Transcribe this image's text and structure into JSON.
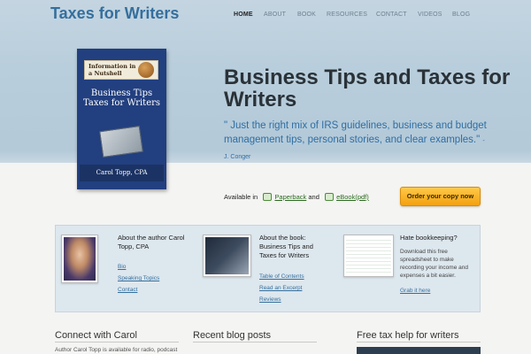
{
  "site": {
    "title": "Taxes for Writers"
  },
  "nav": {
    "items": [
      {
        "label": "HOME",
        "active": true
      },
      {
        "label": "ABOUT",
        "active": false
      },
      {
        "label": "BOOK",
        "active": false
      },
      {
        "label": "RESOURCES",
        "active": false
      },
      {
        "label": "CONTACT",
        "active": false
      },
      {
        "label": "VIDEOS",
        "active": false
      },
      {
        "label": "BLOG",
        "active": false
      }
    ]
  },
  "book_cover": {
    "banner": "Information in a Nutshell",
    "title": "Business Tips Taxes for Writers",
    "author": "Carol Topp, CPA"
  },
  "hero": {
    "heading": "Business Tips and Taxes for Writers",
    "quote": "\" Just the right mix of IRS guidelines, business and budget management tips, personal stories, and clear examples.\"",
    "quote_cite": "- J. Conger"
  },
  "availability": {
    "prefix": "Available in",
    "paperback": "Paperback",
    "and": "and",
    "ebook": "eBook(pdf)"
  },
  "order_button": "Order your copy now",
  "cards": [
    {
      "title": "About the author Carol Topp, CPA",
      "links": [
        "Bio",
        "Speaking Topics",
        "Contact"
      ],
      "image_icon": "author-photo"
    },
    {
      "title": "About the book: Business Tips and Taxes for Writers",
      "links": [
        "Table of Contents",
        "Read an Excerpt",
        "Reviews"
      ],
      "image_icon": "profit-image"
    },
    {
      "title": "Hate bookkeeping?",
      "text": "Download this free spreadsheet to make recording your income and expenses a bit easier.",
      "links": [
        "Grab it here"
      ],
      "image_icon": "spreadsheet-image"
    }
  ],
  "footer_columns": [
    {
      "heading": "Connect with Carol",
      "text": "Author Carol Topp is available for radio, podcast"
    },
    {
      "heading": "Recent blog posts",
      "text": ""
    },
    {
      "heading": "Free tax help for writers",
      "text": ""
    }
  ],
  "colors": {
    "accent": "#356f9d",
    "order_button": "#f3a10e",
    "link_green": "#2b6b1f"
  }
}
